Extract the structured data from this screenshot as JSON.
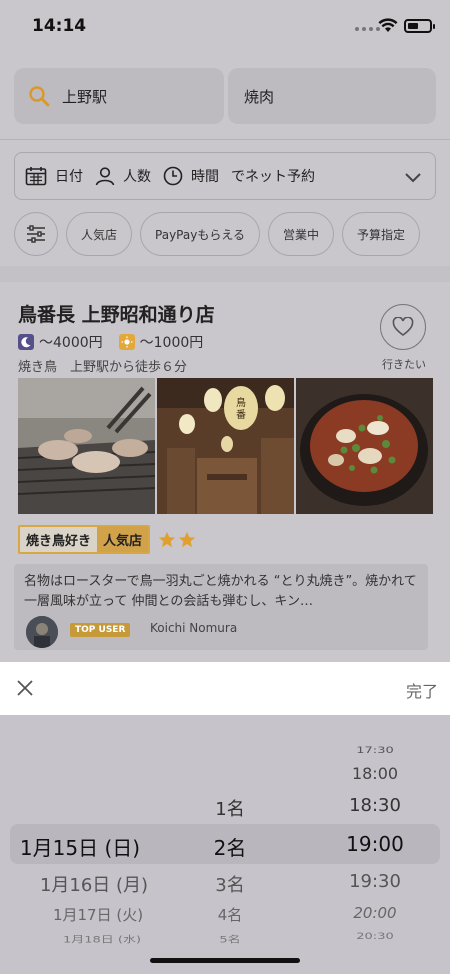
{
  "status_bar": {
    "time": "14:14"
  },
  "search": {
    "station": "上野駅",
    "keyword": "焼肉"
  },
  "conditions": {
    "date_label": "日付",
    "people_label": "人数",
    "time_label": "時間",
    "net_reserve_label": "でネット予約"
  },
  "filter_chips": [
    "人気店",
    "PayPayもらえる",
    "営業中",
    "予算指定"
  ],
  "restaurant": {
    "name": "鳥番長 上野昭和通り店",
    "dinner_price": "～4000円",
    "lunch_price": "～1000円",
    "genre_access": "焼き鳥　上野駅から徒歩６分",
    "favorite_label": "行きたい",
    "tags": [
      "焼き鳥好き",
      "人気店"
    ],
    "star_count": 2,
    "review": {
      "text": "名物はロースターで鳥一羽丸ごと焼かれる “とり丸焼き”。焼かれて一層風味が立って 仲間との会話も弾むし、キン…",
      "badge": "TOP USER",
      "reviewer": "Koichi  Nomura"
    }
  },
  "picker_sheet": {
    "done_label": "完了",
    "dates": {
      "selected": "1月15日 (日)",
      "next": [
        "1月16日 (月)",
        "1月17日 (火)",
        "1月18日 (水)"
      ]
    },
    "people": {
      "prev": "1名",
      "selected": "2名",
      "next": [
        "3名",
        "4名",
        "5名"
      ]
    },
    "times": {
      "prev": [
        "17:30",
        "18:00",
        "18:30"
      ],
      "selected": "19:00",
      "next": [
        "19:30",
        "20:00",
        "20:30"
      ]
    }
  },
  "colors": {
    "accent_gold": "#d1a24a",
    "star": "#e0a030",
    "night_icon": "#56508a",
    "day_icon": "#e2a93a"
  }
}
